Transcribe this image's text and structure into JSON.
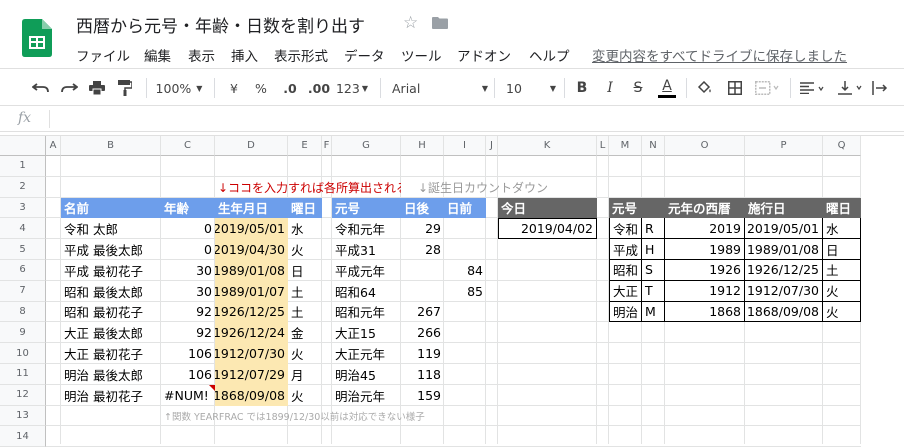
{
  "title": "西暦から元号・年齢・日数を割り出す",
  "save_status": "変更内容をすべてドライブに保存しました",
  "menu": [
    "ファイル",
    "編集",
    "表示",
    "挿入",
    "表示形式",
    "データ",
    "ツール",
    "アドオン",
    "ヘルプ"
  ],
  "toolbar": {
    "zoom": "100%",
    "currency": "¥",
    "percent": "%",
    "dec_decrease": ".0",
    "dec_increase": ".00",
    "more_formats": "123",
    "font": "Arial",
    "font_size": "10",
    "bold": "B",
    "italic": "I",
    "strike": "S",
    "text_color": "A"
  },
  "formula": {
    "fx": "fx"
  },
  "columns": [
    "A",
    "B",
    "C",
    "D",
    "E",
    "F",
    "G",
    "H",
    "I",
    "J",
    "K",
    "L",
    "M",
    "N",
    "O",
    "P",
    "Q"
  ],
  "rows": [
    "1",
    "2",
    "3",
    "4",
    "5",
    "6",
    "7",
    "8",
    "9",
    "10",
    "11",
    "12",
    "13",
    "14"
  ],
  "notes": {
    "note1": "↓ココを入力すれば各所算出される",
    "note2": "↓誕生日カウントダウン",
    "note3": "↑関数 YEARFRAC では1899/12/30以前は対応できない様子"
  },
  "table1": {
    "headers": [
      "名前",
      "年齢",
      "生年月日",
      "曜日"
    ],
    "rows": [
      [
        "令和 太郎",
        "0",
        "2019/05/01",
        "水"
      ],
      [
        "平成 最後太郎",
        "0",
        "2019/04/30",
        "火"
      ],
      [
        "平成 最初花子",
        "30",
        "1989/01/08",
        "日"
      ],
      [
        "昭和 最後太郎",
        "30",
        "1989/01/07",
        "土"
      ],
      [
        "昭和 最初花子",
        "92",
        "1926/12/25",
        "土"
      ],
      [
        "大正 最後太郎",
        "92",
        "1926/12/24",
        "金"
      ],
      [
        "大正 最初花子",
        "106",
        "1912/07/30",
        "火"
      ],
      [
        "明治 最後太郎",
        "106",
        "1912/07/29",
        "月"
      ],
      [
        "明治 最初花子",
        "#NUM!",
        "1868/09/08",
        "火"
      ]
    ]
  },
  "table2": {
    "headers": [
      "元号",
      "日後",
      "日前"
    ],
    "rows": [
      [
        "令和元年",
        "29",
        ""
      ],
      [
        "平成31",
        "28",
        ""
      ],
      [
        "平成元年",
        "",
        "84"
      ],
      [
        "昭和64",
        "",
        "85"
      ],
      [
        "昭和元年",
        "267",
        ""
      ],
      [
        "大正15",
        "266",
        ""
      ],
      [
        "大正元年",
        "119",
        ""
      ],
      [
        "明治45",
        "118",
        ""
      ],
      [
        "明治元年",
        "159",
        ""
      ]
    ]
  },
  "today": {
    "header": "今日",
    "value": "2019/04/02"
  },
  "era_table": {
    "headers": [
      "元号",
      "",
      "元年の西暦",
      "施行日",
      "曜日"
    ],
    "rows": [
      [
        "令和",
        "R",
        "2019",
        "2019/05/01",
        "水"
      ],
      [
        "平成",
        "H",
        "1989",
        "1989/01/08",
        "日"
      ],
      [
        "昭和",
        "S",
        "1926",
        "1926/12/25",
        "土"
      ],
      [
        "大正",
        "T",
        "1912",
        "1912/07/30",
        "火"
      ],
      [
        "明治",
        "M",
        "1868",
        "1868/09/08",
        "火"
      ]
    ]
  },
  "colors": {
    "header_blue": "#6d9eeb",
    "header_gray": "#666666",
    "date_fill": "#fce8b2",
    "note_red": "#cc0000",
    "sheets_green": "#0f9d58"
  }
}
